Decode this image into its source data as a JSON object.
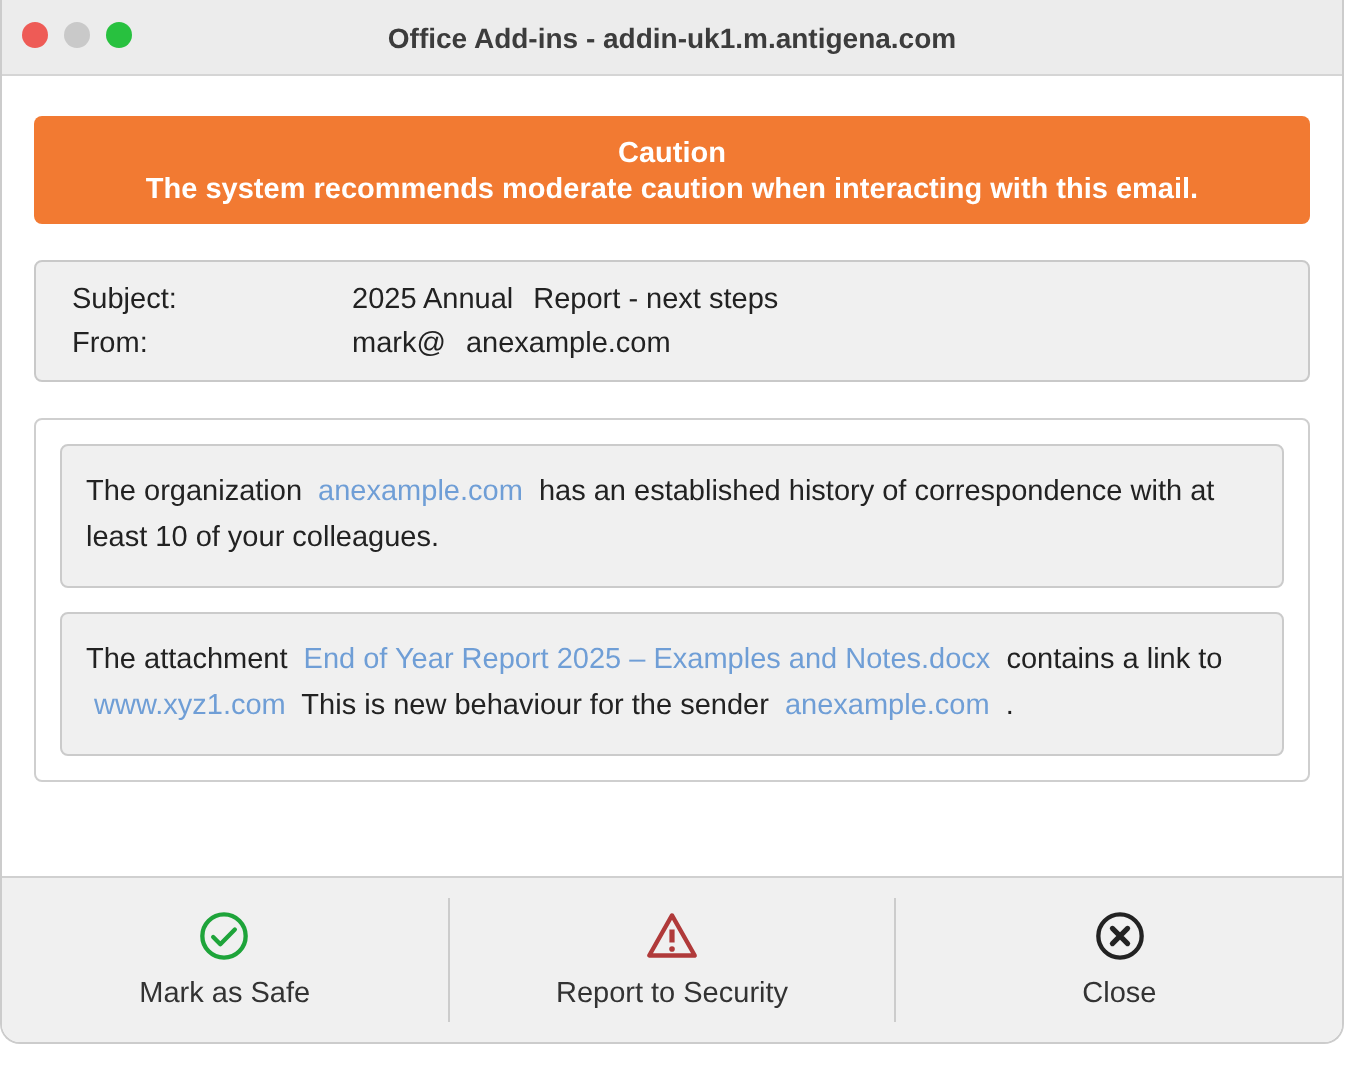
{
  "window": {
    "title": "Office Add-ins - addin-uk1.m.antigena.com"
  },
  "banner": {
    "title": "Caution",
    "message": "The system recommends moderate caution when interacting with this email."
  },
  "email": {
    "fields": [
      {
        "label": "Subject:",
        "parts": [
          "2025 Annual",
          "Report - next steps"
        ]
      },
      {
        "label": "From:",
        "parts": [
          "mark@",
          "anexample.com"
        ]
      }
    ]
  },
  "notices": [
    {
      "segments": [
        {
          "kind": "text",
          "text": "The organization"
        },
        {
          "kind": "link",
          "text": "anexample.com"
        },
        {
          "kind": "text",
          "text": "has an established history of correspondence with at least 10 of your colleagues."
        }
      ]
    },
    {
      "segments": [
        {
          "kind": "text",
          "text": "The attachment"
        },
        {
          "kind": "link",
          "text": "End of Year Report 2025 – Examples and Notes.docx"
        },
        {
          "kind": "text",
          "text": "contains a link to"
        },
        {
          "kind": "link",
          "text": "www.xyz1.com"
        },
        {
          "kind": "text",
          "text": "This is new behaviour for the sender"
        },
        {
          "kind": "link",
          "text": "anexample.com"
        },
        {
          "kind": "text",
          "text": "."
        }
      ]
    }
  ],
  "actions": [
    {
      "kind": "safe",
      "label": "Mark as Safe"
    },
    {
      "kind": "report",
      "label": "Report to Security"
    },
    {
      "kind": "close",
      "label": "Close"
    }
  ]
}
